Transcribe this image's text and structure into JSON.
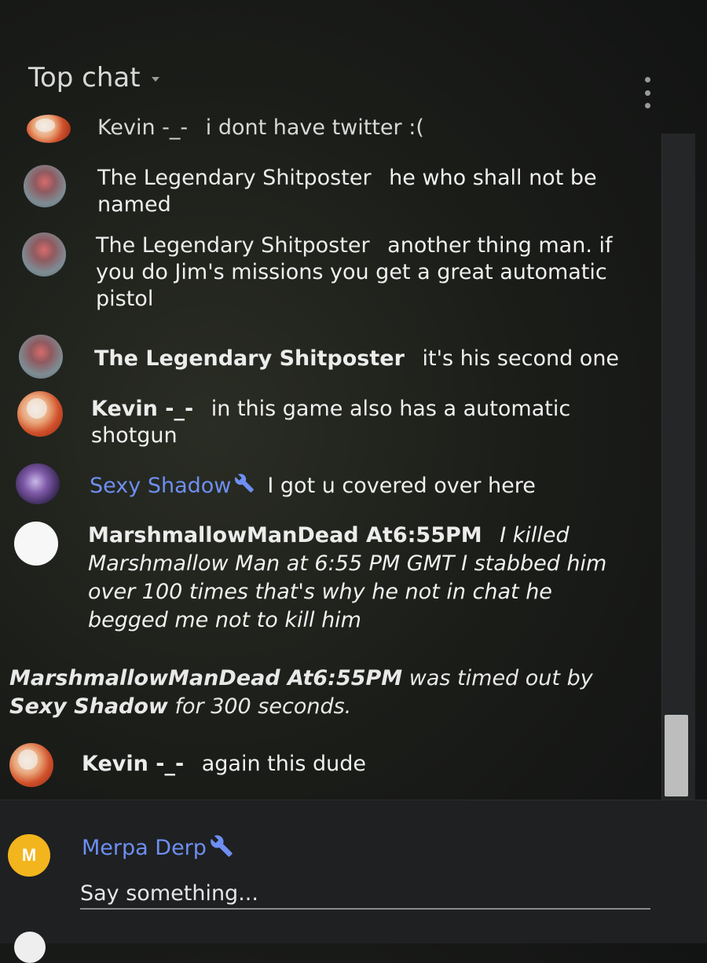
{
  "header": {
    "title": "Top chat"
  },
  "messages": [
    {
      "author": "Kevin -_-",
      "text": "i dont have twitter :("
    },
    {
      "author": "The Legendary Shitposter",
      "text": "he who shall not be named"
    },
    {
      "author": "The Legendary Shitposter",
      "text": "another thing man. if you do Jim's missions you get a great automatic pistol"
    },
    {
      "author": "The Legendary Shitposter",
      "text": "it's his second one"
    },
    {
      "author": "Kevin -_-",
      "text": "in this game also has a automatic shotgun"
    },
    {
      "author": "Sexy Shadow",
      "text": "I got u covered over here"
    },
    {
      "author": "MarshmallowManDead At6:55PM",
      "text": "I killed Marshmallow Man at 6:55 PM GMT I stabbed him over 100 times that's why he not in chat he begged me not to kill him"
    },
    {
      "author": "Kevin -_-",
      "text": "again this dude"
    }
  ],
  "timeout_notice": {
    "user": "MarshmallowManDead At6:55PM",
    "middle": "was timed out by",
    "moderator": "Sexy Shadow",
    "suffix": "for 300 seconds."
  },
  "composer": {
    "avatar_letter": "M",
    "author": "Merpa Derp",
    "placeholder": "Say something..."
  },
  "icons": {
    "menu": "more-vert-icon",
    "dropdown": "chevron-down-icon",
    "moderator": "wrench-icon"
  },
  "colors": {
    "moderator_name": "#6e8ff2",
    "composer_avatar": "#f3b51d"
  }
}
